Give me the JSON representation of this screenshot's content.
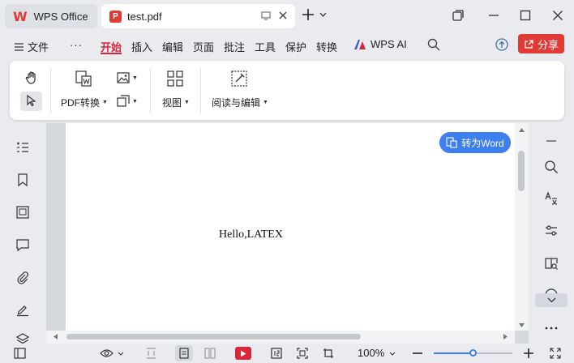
{
  "tabs": {
    "home": {
      "label": "WPS Office"
    },
    "doc": {
      "label": "test.pdf"
    }
  },
  "menu": {
    "file": "文件",
    "more": "···",
    "items": [
      "开始",
      "插入",
      "编辑",
      "页面",
      "批注",
      "工具",
      "保护",
      "转换"
    ],
    "ai": "WPS AI",
    "share": "分享"
  },
  "ribbon": {
    "pdf_convert": "PDF转换",
    "view": "视图",
    "read_edit": "阅读与编辑"
  },
  "document": {
    "text": "Hello,LATEX",
    "to_word": "转为Word"
  },
  "status": {
    "zoom": "100%",
    "zoom_level": 0.5
  },
  "colors": {
    "accent_red": "#e23a35",
    "accent_blue": "#3d7ef0"
  }
}
